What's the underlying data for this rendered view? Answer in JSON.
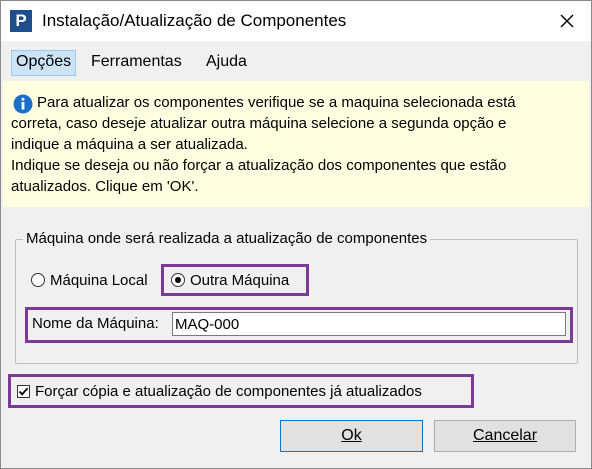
{
  "window": {
    "title": "Instalação/Atualização de Componentes",
    "app_icon_letter": "P"
  },
  "menu": {
    "items": [
      "Opções",
      "Ferramentas",
      "Ajuda"
    ]
  },
  "info": {
    "lines": [
      "Para atualizar os componentes verifique se a maquina selecionada está",
      "correta, caso deseje atualizar outra máquina selecione a segunda opção e",
      "indique a máquina a ser atualizada.",
      "Indique se deseja ou não forçar a atualização dos componentes que estão",
      "atualizados. Clique em 'OK'."
    ]
  },
  "group": {
    "legend": "Máquina onde será realizada a atualização de componentes",
    "radio_local": "Máquina Local",
    "radio_other": "Outra Máquina",
    "selected": "Outra Máquina",
    "machine_name_label": "Nome da Máquina:",
    "machine_name_value": "MAQ-000"
  },
  "force": {
    "label": "Forçar cópia e atualização de componentes já atualizados",
    "checked": true
  },
  "buttons": {
    "ok": "Ok",
    "cancel": "Cancelar"
  },
  "colors": {
    "highlight": "#7b3a96",
    "info_background": "#ffffe1",
    "menu_active": "#cce4f7"
  }
}
